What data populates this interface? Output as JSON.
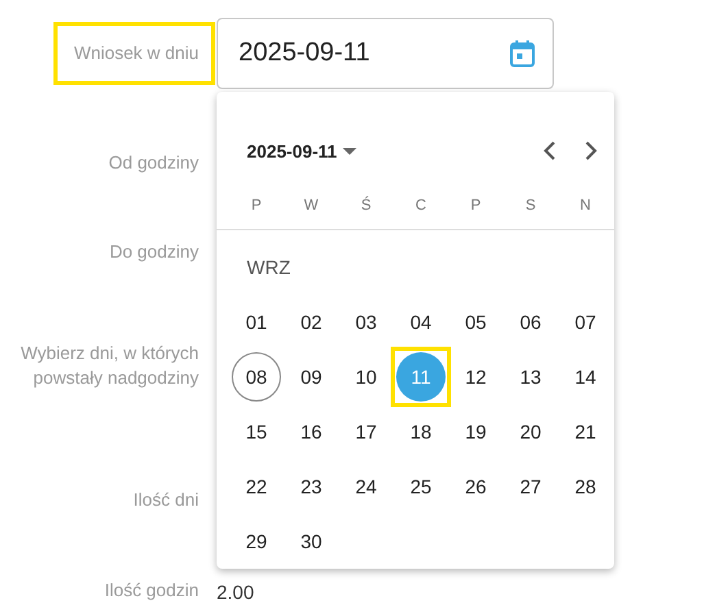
{
  "form": [
    {
      "label": "Wniosek w dniu",
      "highlighted": true,
      "kind": "date",
      "value": "2025-09-11"
    },
    {
      "label": "Od godziny",
      "highlighted": false,
      "kind": "plain"
    },
    {
      "label": "Do godziny",
      "highlighted": false,
      "kind": "plain"
    },
    {
      "label": "Wybierz dni, w których powstały nadgodziny",
      "highlighted": false,
      "kind": "plain"
    },
    {
      "label": "Ilość dni",
      "highlighted": false,
      "kind": "plain"
    },
    {
      "label": "Ilość godzin",
      "highlighted": false,
      "kind": "text",
      "value": "2.00"
    }
  ],
  "calendar": {
    "header": "2025-09-11",
    "weekdays": [
      "P",
      "W",
      "Ś",
      "C",
      "P",
      "S",
      "N"
    ],
    "month": "WRZ",
    "days": [
      {
        "label": "01",
        "selected": false,
        "today": false,
        "highlighted": false
      },
      {
        "label": "02",
        "selected": false,
        "today": false,
        "highlighted": false
      },
      {
        "label": "03",
        "selected": false,
        "today": false,
        "highlighted": false
      },
      {
        "label": "04",
        "selected": false,
        "today": false,
        "highlighted": false
      },
      {
        "label": "05",
        "selected": false,
        "today": false,
        "highlighted": false
      },
      {
        "label": "06",
        "selected": false,
        "today": false,
        "highlighted": false
      },
      {
        "label": "07",
        "selected": false,
        "today": false,
        "highlighted": false
      },
      {
        "label": "08",
        "selected": false,
        "today": true,
        "highlighted": false
      },
      {
        "label": "09",
        "selected": false,
        "today": false,
        "highlighted": false
      },
      {
        "label": "10",
        "selected": false,
        "today": false,
        "highlighted": false
      },
      {
        "label": "11",
        "selected": true,
        "today": false,
        "highlighted": true
      },
      {
        "label": "12",
        "selected": false,
        "today": false,
        "highlighted": false
      },
      {
        "label": "13",
        "selected": false,
        "today": false,
        "highlighted": false
      },
      {
        "label": "14",
        "selected": false,
        "today": false,
        "highlighted": false
      },
      {
        "label": "15",
        "selected": false,
        "today": false,
        "highlighted": false
      },
      {
        "label": "16",
        "selected": false,
        "today": false,
        "highlighted": false
      },
      {
        "label": "17",
        "selected": false,
        "today": false,
        "highlighted": false
      },
      {
        "label": "18",
        "selected": false,
        "today": false,
        "highlighted": false
      },
      {
        "label": "19",
        "selected": false,
        "today": false,
        "highlighted": false
      },
      {
        "label": "20",
        "selected": false,
        "today": false,
        "highlighted": false
      },
      {
        "label": "21",
        "selected": false,
        "today": false,
        "highlighted": false
      },
      {
        "label": "22",
        "selected": false,
        "today": false,
        "highlighted": false
      },
      {
        "label": "23",
        "selected": false,
        "today": false,
        "highlighted": false
      },
      {
        "label": "24",
        "selected": false,
        "today": false,
        "highlighted": false
      },
      {
        "label": "25",
        "selected": false,
        "today": false,
        "highlighted": false
      },
      {
        "label": "26",
        "selected": false,
        "today": false,
        "highlighted": false
      },
      {
        "label": "27",
        "selected": false,
        "today": false,
        "highlighted": false
      },
      {
        "label": "28",
        "selected": false,
        "today": false,
        "highlighted": false
      },
      {
        "label": "29",
        "selected": false,
        "today": false,
        "highlighted": false
      },
      {
        "label": "30",
        "selected": false,
        "today": false,
        "highlighted": false
      }
    ]
  }
}
